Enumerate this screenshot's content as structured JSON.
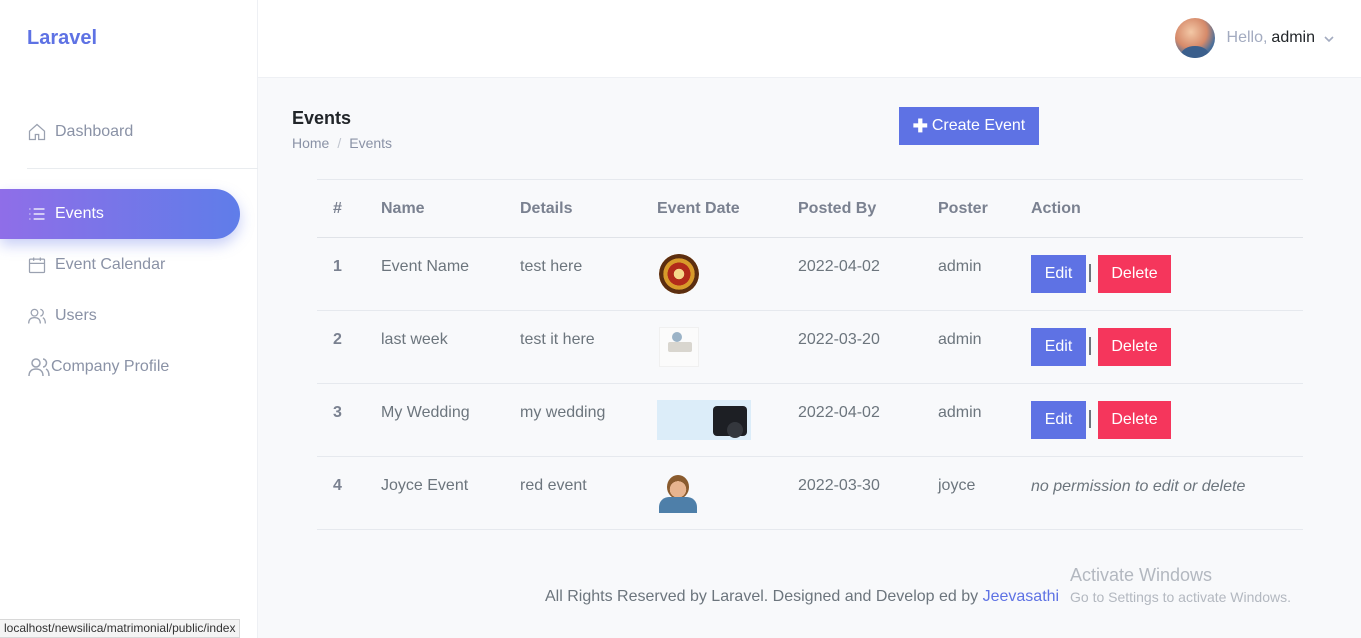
{
  "brand": "Laravel",
  "sidebar": {
    "items": [
      {
        "label": "Dashboard",
        "icon": "home-icon"
      },
      {
        "label": "Events",
        "icon": "list-icon",
        "active": true
      },
      {
        "label": "Event Calendar",
        "icon": "calendar-icon"
      },
      {
        "label": "Users",
        "icon": "users-icon"
      },
      {
        "label": "Company Profile",
        "icon": "users-group-icon"
      }
    ]
  },
  "header": {
    "greeting": "Hello,",
    "username": "admin"
  },
  "page": {
    "title": "Events",
    "breadcrumb": [
      "Home",
      "Events"
    ],
    "breadcrumb_sep": "/",
    "create_button": "Create Event"
  },
  "table": {
    "columns": [
      "#",
      "Name",
      "Details",
      "Event Date",
      "Posted By",
      "Poster",
      "Action"
    ],
    "rows": [
      {
        "num": "1",
        "name": "Event Name",
        "details": "test here",
        "date": "2022-04-02",
        "poster": "admin",
        "can_edit": true
      },
      {
        "num": "2",
        "name": "last week",
        "details": "test it here",
        "date": "2022-03-20",
        "poster": "admin",
        "can_edit": true
      },
      {
        "num": "3",
        "name": "My Wedding",
        "details": "my wedding",
        "date": "2022-04-02",
        "poster": "admin",
        "can_edit": true
      },
      {
        "num": "4",
        "name": "Joyce Event",
        "details": "red event",
        "date": "2022-03-30",
        "poster": "joyce",
        "can_edit": false
      }
    ],
    "edit_label": "Edit",
    "delete_label": "Delete",
    "no_permission": "no permission to edit or delete"
  },
  "footer": {
    "text": "All Rights Reserved by Laravel. Designed and Develop ed by",
    "link": "Jeevasathi"
  },
  "windows_watermark": {
    "title": "Activate Windows",
    "subtitle": "Go to Settings to activate Windows."
  },
  "status_url": "localhost/newsilica/matrimonial/public/index",
  "colors": {
    "primary": "#5e72e4",
    "danger": "#f5365c"
  }
}
